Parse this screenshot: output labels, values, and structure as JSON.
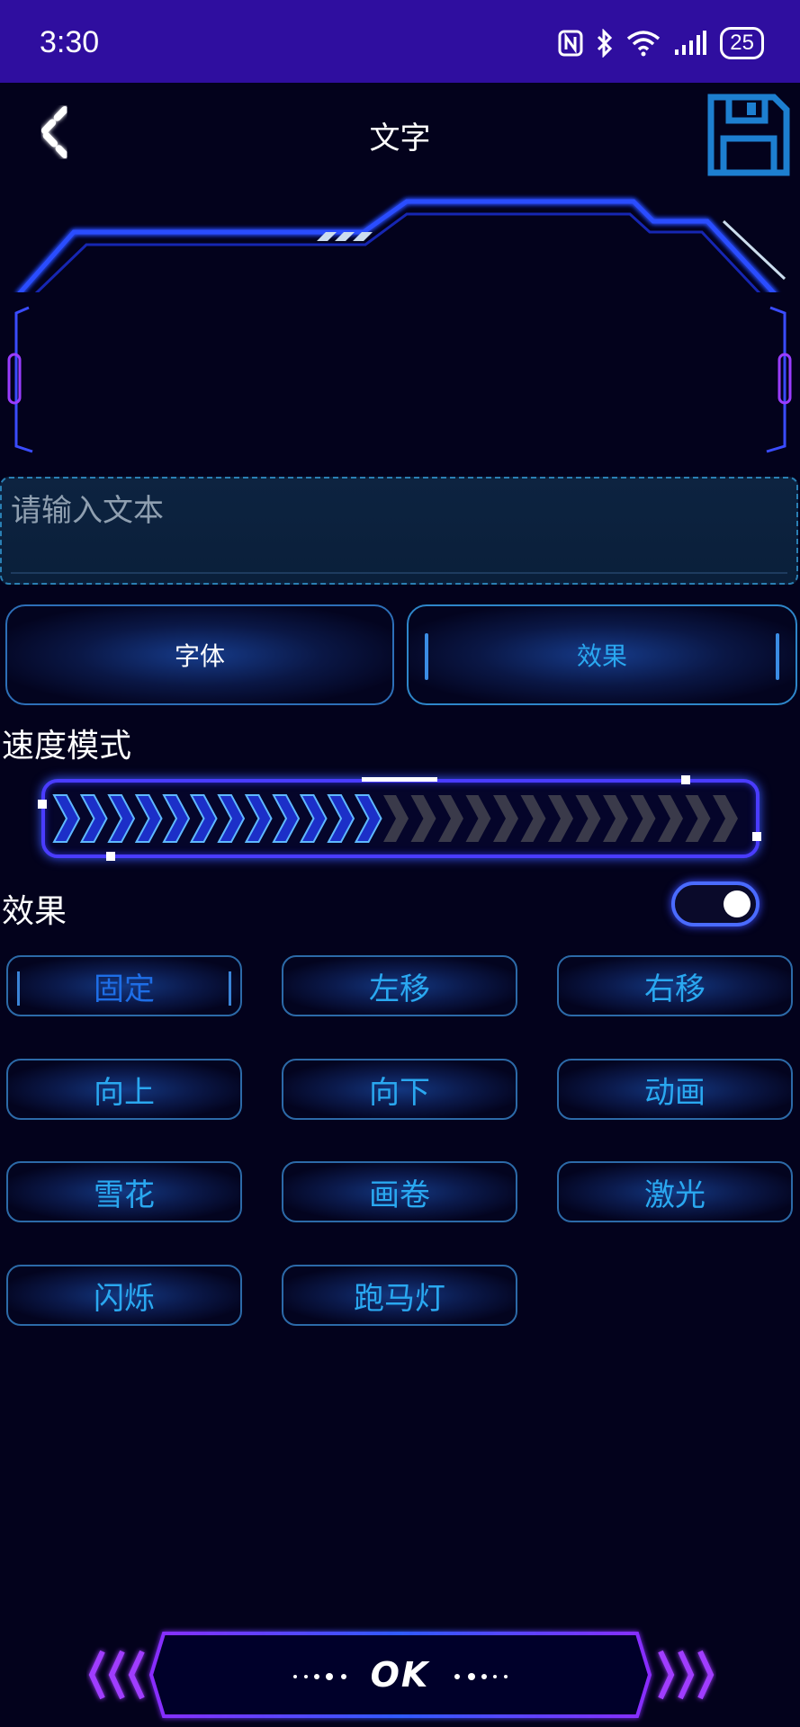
{
  "status_bar": {
    "time": "3:30",
    "battery": "25",
    "icons": [
      "nfc-icon",
      "bluetooth-icon",
      "wifi-icon",
      "signal-icon",
      "battery-icon"
    ]
  },
  "header": {
    "title": "文字",
    "back_icon": "back-chevron-icon",
    "save_icon": "save-disk-icon"
  },
  "text_input": {
    "placeholder": "请输入文本",
    "value": ""
  },
  "tabs": [
    {
      "label": "字体",
      "active": false
    },
    {
      "label": "效果",
      "active": true
    }
  ],
  "speed": {
    "label": "速度模式",
    "level": 0.49
  },
  "effect_section": {
    "label": "效果",
    "toggle_on": true
  },
  "effects": [
    {
      "label": "固定",
      "selected": true
    },
    {
      "label": "左移",
      "selected": false
    },
    {
      "label": "右移",
      "selected": false
    },
    {
      "label": "向上",
      "selected": false
    },
    {
      "label": "向下",
      "selected": false
    },
    {
      "label": "动画",
      "selected": false
    },
    {
      "label": "雪花",
      "selected": false
    },
    {
      "label": "画卷",
      "selected": false
    },
    {
      "label": "激光",
      "selected": false
    },
    {
      "label": "闪烁",
      "selected": false
    },
    {
      "label": "跑马灯",
      "selected": false
    }
  ],
  "ok_button": {
    "label": "OK"
  },
  "colors": {
    "background": "#03021c",
    "status_bar": "#2f0e9f",
    "accent_blue": "#2aa8f0",
    "neon_purple": "#8a3cff"
  }
}
